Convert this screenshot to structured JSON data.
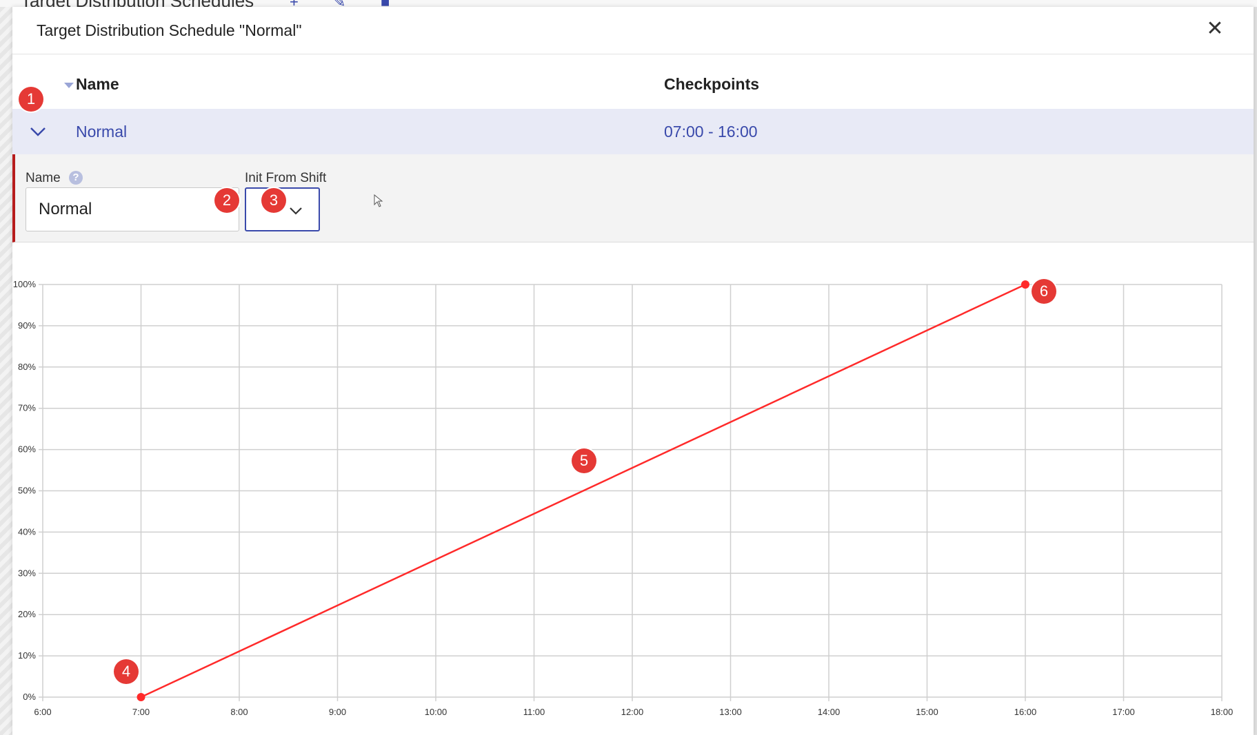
{
  "background": {
    "title": "Target Distribution Schedules"
  },
  "dialog": {
    "title": "Target Distribution Schedule \"Normal\"",
    "close_icon": "close-icon"
  },
  "table": {
    "columns": [
      "Name",
      "Checkpoints"
    ],
    "rows": [
      {
        "name": "Normal",
        "checkpoints": "07:00 - 16:00"
      }
    ]
  },
  "form": {
    "name_label": "Name",
    "name_value": "Normal",
    "init_label": "Init From Shift"
  },
  "badges": [
    "1",
    "2",
    "3",
    "4",
    "5",
    "6"
  ],
  "colors": {
    "accent": "#3949ab",
    "row_highlight": "#e8eaf6",
    "line": "#ff2a2a",
    "badge": "#e53935"
  },
  "chart_data": {
    "type": "line",
    "x_ticks": [
      "6:00",
      "7:00",
      "8:00",
      "9:00",
      "10:00",
      "11:00",
      "12:00",
      "13:00",
      "14:00",
      "15:00",
      "16:00",
      "17:00",
      "18:00"
    ],
    "y_ticks": [
      "0%",
      "10%",
      "20%",
      "30%",
      "40%",
      "50%",
      "60%",
      "70%",
      "80%",
      "90%",
      "100%"
    ],
    "xlim": [
      6,
      18
    ],
    "ylim": [
      0,
      100
    ],
    "grid": true,
    "series": [
      {
        "points": [
          {
            "x": 7,
            "y": 0,
            "label": "7:00"
          },
          {
            "x": 16,
            "y": 100,
            "label": "16:00"
          }
        ]
      }
    ]
  }
}
